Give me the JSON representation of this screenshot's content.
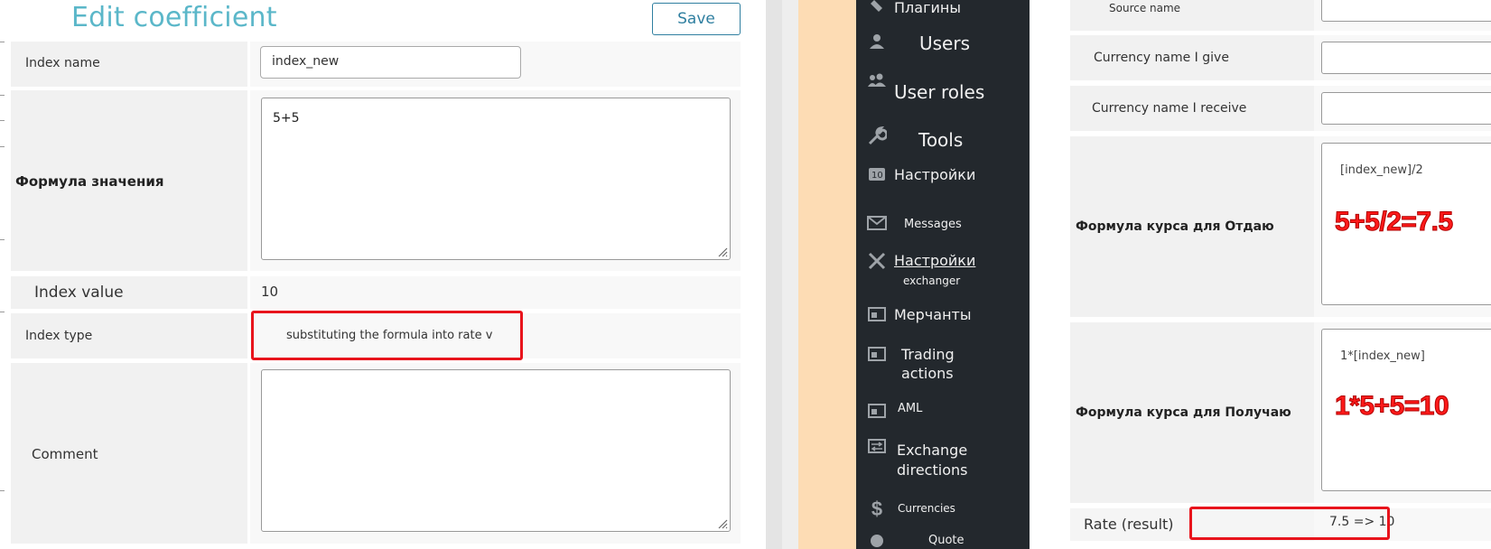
{
  "left": {
    "title": "Edit coefficient",
    "save_label": "Save",
    "fields": {
      "index_name_label": "Index name",
      "index_name_value": "index_new",
      "formula_label": "Формула значения",
      "formula_value": "5+5",
      "index_value_label": "Index value",
      "index_value": "10",
      "index_type_label": "Index type",
      "index_type_value": "substituting the formula into rate v",
      "comment_label": "Comment",
      "comment_value": ""
    }
  },
  "sidebar": {
    "items": [
      {
        "label": "Плагины",
        "icon": "plugin-icon"
      },
      {
        "label": "Users",
        "icon": "user-icon"
      },
      {
        "label": "User roles",
        "icon": "users-group-icon"
      },
      {
        "label": "Tools",
        "icon": "wrench-icon"
      },
      {
        "label": "Настройки",
        "icon": "settings-icon"
      },
      {
        "label": "Messages",
        "icon": "mail-icon"
      },
      {
        "label": "Настройки",
        "sublabel": "exchanger",
        "icon": "tools-icon"
      },
      {
        "label": "Мерчанты",
        "icon": "merchant-icon"
      },
      {
        "label": "Trading",
        "sublabel": "actions",
        "icon": "trading-icon"
      },
      {
        "label": "AML",
        "icon": "aml-icon"
      },
      {
        "label": "Exchange",
        "sublabel": "directions",
        "icon": "exchange-icon"
      },
      {
        "label": "Currencies",
        "icon": "dollar-icon"
      },
      {
        "label": "Quote",
        "icon": "quote-icon"
      }
    ]
  },
  "right": {
    "source_name_label": "Source name",
    "currency_give_label": "Currency name I give",
    "currency_receive_label": "Currency name I receive",
    "formula_give_label": "Формула курса для Отдаю",
    "formula_give_value": "[index_new]/2",
    "formula_give_annotation": "5+5/2=7.5",
    "formula_receive_label": "Формула курса для Получаю",
    "formula_receive_value": "1*[index_new]",
    "formula_receive_annotation": "1*5+5=10",
    "rate_label": "Rate (result)",
    "rate_value": "7.5 => 10"
  },
  "colors": {
    "title": "#5bb7c9",
    "highlight": "#e8141c",
    "sidebar_bg": "#23282d",
    "peach": "#fddcb4"
  }
}
